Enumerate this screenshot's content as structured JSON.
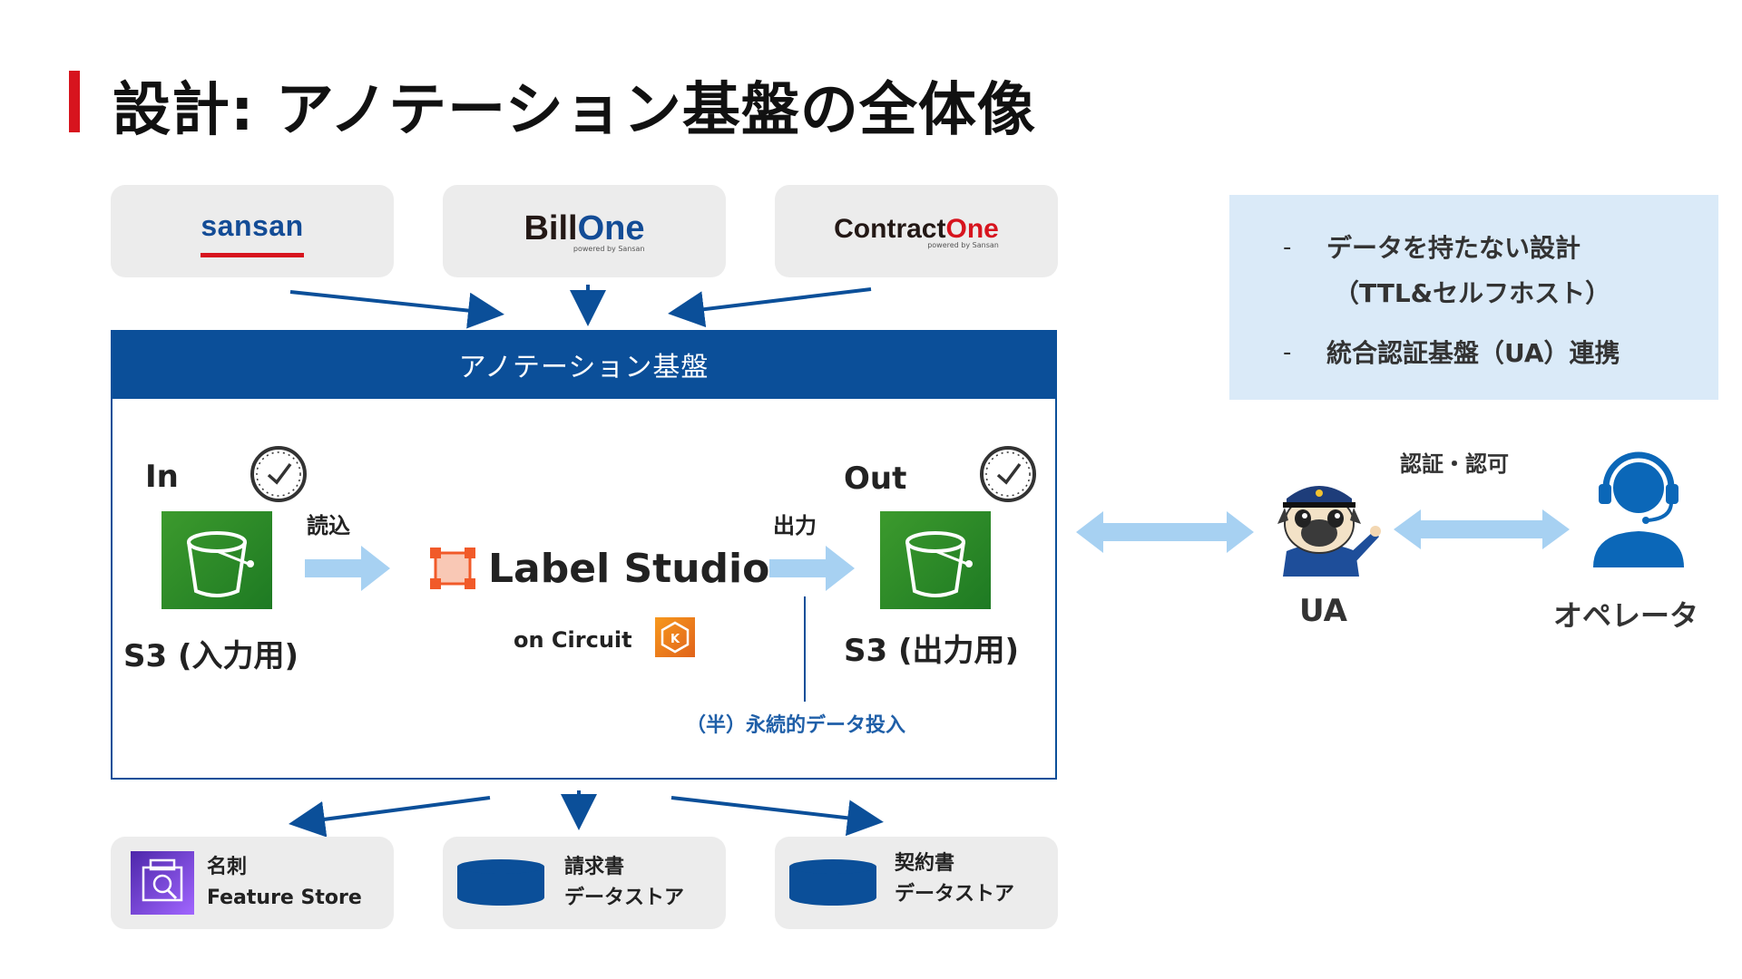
{
  "title": "設計: アノテーション基盤の全体像",
  "products": {
    "sansan": "sansan",
    "billone_bill": "Bill",
    "billone_one": "One",
    "billone_sub": "powered by Sansan",
    "contract_contract": "Contract",
    "contract_one": "One",
    "contract_sub": "powered by Sansan"
  },
  "platform": {
    "header": "アノテーション基盤",
    "in_label": "In",
    "out_label": "Out",
    "read_label": "読込",
    "output_label": "出力",
    "s3_in": "S3 (入力用)",
    "s3_out": "S3 (出力用)",
    "label_studio": "Label Studio",
    "on_circuit": "on Circuit",
    "persistent": "（半）永続的データ投入"
  },
  "stores": {
    "meishi_title": "名刺",
    "meishi_sub": "Feature Store",
    "invoice_title": "請求書",
    "invoice_sub": "データストア",
    "contract_title": "契約書",
    "contract_sub": "データストア"
  },
  "notes": {
    "dash": "-",
    "line1": "データを持たない設計",
    "line1b": "（TTL&セルフホスト）",
    "line2": "統合認証基盤（UA）連携"
  },
  "right": {
    "ua": "UA",
    "operator": "オペレータ",
    "auth": "認証・認可"
  },
  "colors": {
    "brand_red": "#d7141e",
    "platform_blue": "#0b4f99",
    "arrow_light_blue": "#a7d1f2",
    "note_bg": "#daeaf8"
  }
}
